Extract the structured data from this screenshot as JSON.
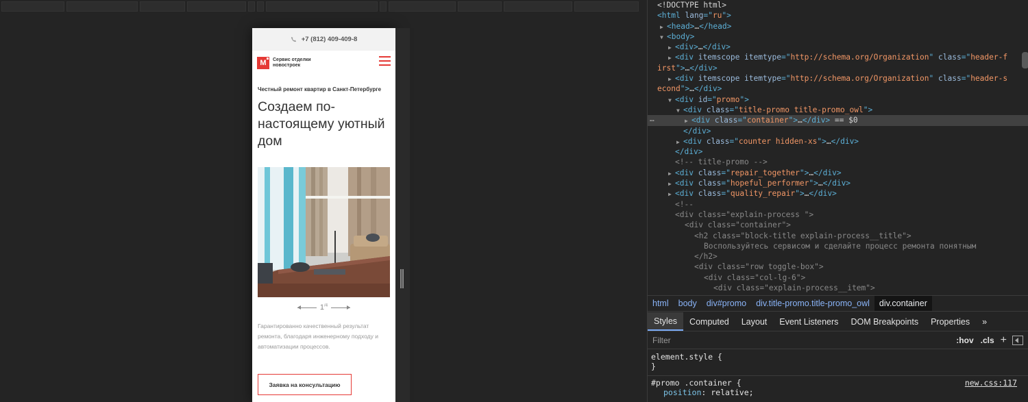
{
  "device": {
    "phone": "+7 (812) 409-409-8",
    "logo_letter": "M",
    "logo_text": "Сервис отделки новостроек",
    "promo_sub": "Честный ремонт квартир в Санкт-Петербурге",
    "promo_title": "Создаем по-настоящему уютный дом",
    "pager_current": "1",
    "pager_total": "/4",
    "promo_desc": "Гарантированно качественный результат ремонта, благодаря инженерному подходу и автоматизации процессов.",
    "cta_label": "Заявка на консультацию"
  },
  "dom": {
    "doctype": "<!DOCTYPE html>",
    "lines": [
      {
        "tag": "html",
        "attrs": " lang=\"ru\"",
        "indent": 0
      },
      {
        "text": "head"
      },
      {
        "text": "body"
      }
    ],
    "html_lang": "ru",
    "schema_url": "http://schema.org/Organization",
    "header_first": "header-first",
    "header_second": "header-second",
    "promo_id": "promo",
    "title_promo_class": "title-promo title-promo_owl",
    "container_class": "container",
    "selected_marker": "== $0",
    "counter_class": "counter hidden-xs",
    "comment_title_promo": "<!-- title-promo -->",
    "repair_class": "repair_together",
    "hopeful_class": "hopeful_performer",
    "quality_class": "quality_repair",
    "comment_open": "<!--",
    "explain_class": "explain-process ",
    "h2_class": "block-title explain-process__title",
    "h2_text": "Воспользуйтесь сервисом и сделайте процесс ремонта понятным",
    "row_class": "row toggle-box",
    "col_class": "col-lg-6",
    "item_class": "explain-process__item"
  },
  "breadcrumbs": [
    {
      "label": "html"
    },
    {
      "label": "body"
    },
    {
      "label": "div#promo"
    },
    {
      "label": "div.title-promo.title-promo_owl"
    },
    {
      "label": "div.container"
    }
  ],
  "tabs": [
    "Styles",
    "Computed",
    "Layout",
    "Event Listeners",
    "DOM Breakpoints",
    "Properties",
    "»"
  ],
  "filter": {
    "placeholder": "Filter",
    "hov": ":hov",
    "cls": ".cls",
    "plus": "+"
  },
  "styles": {
    "rule1_selector": "element.style {",
    "rule1_close": "}",
    "rule2_selector": "#promo .container {",
    "rule2_source": "new.css:117",
    "rule2_prop": "position",
    "rule2_value": "relative;"
  },
  "colors": {
    "accent": "#e53935",
    "devtools_bg": "#242424",
    "tag": "#5db0d7",
    "attr_value": "#f29766"
  }
}
